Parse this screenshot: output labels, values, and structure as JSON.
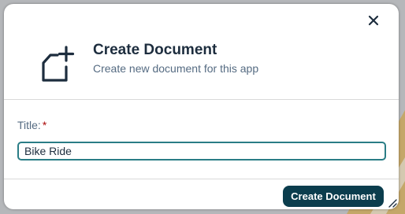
{
  "dialog": {
    "title": "Create Document",
    "subtitle": "Create new document for this app",
    "close_icon": "close-icon",
    "header_icon": "new-document-icon"
  },
  "form": {
    "title_label": "Title:",
    "required_marker": "*",
    "title_value": "Bike Ride"
  },
  "footer": {
    "create_label": "Create Document"
  },
  "colors": {
    "primary_button": "#0b3d4d",
    "input_border": "#2a7d86",
    "required": "#aa0808",
    "backdrop_accent": "#c7a55a"
  }
}
